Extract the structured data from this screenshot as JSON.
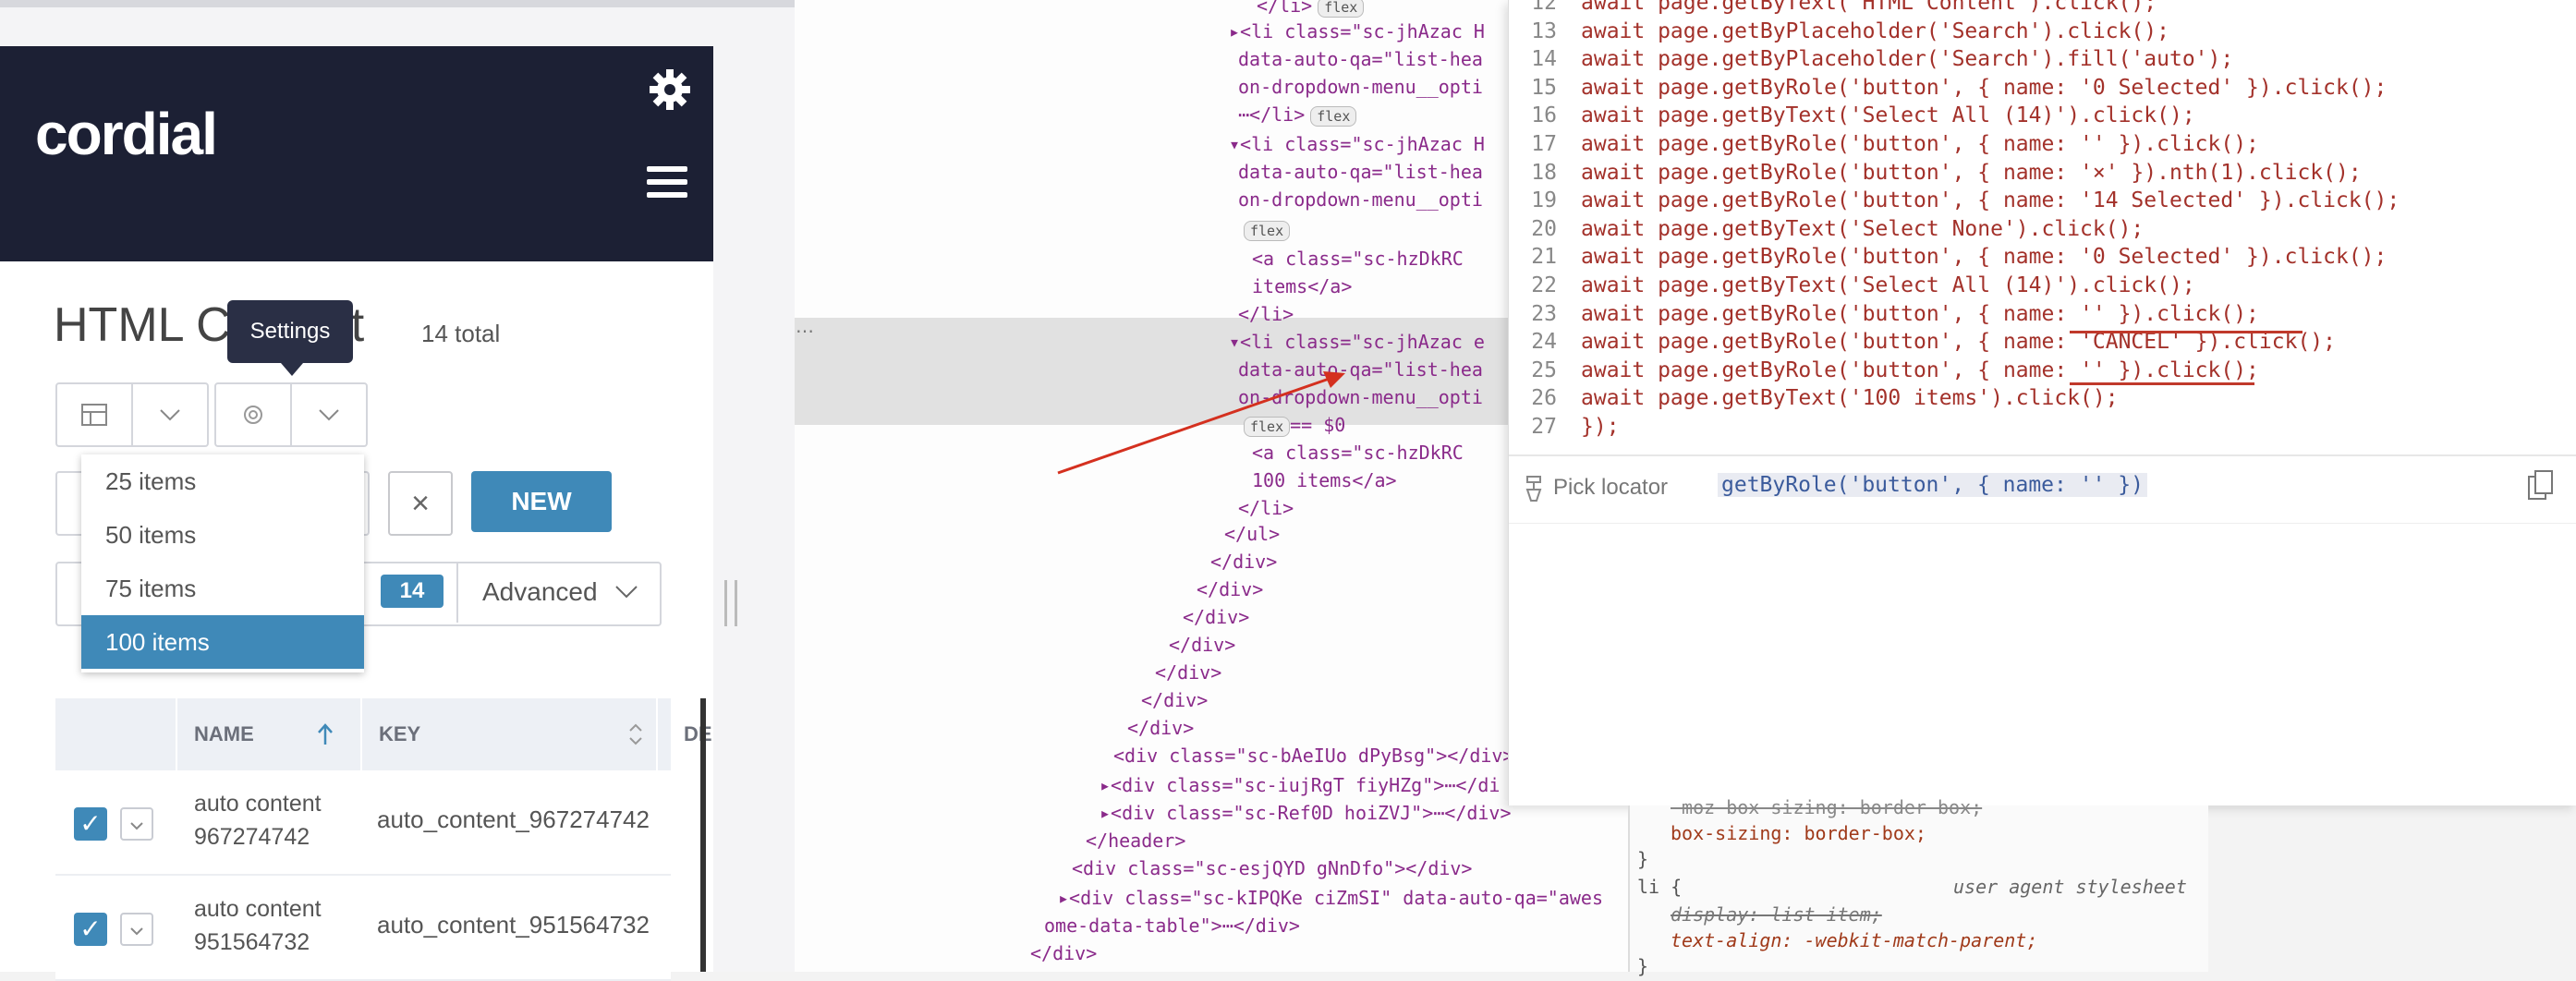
{
  "app": {
    "brand": "cordial",
    "page_title": "HTML Content",
    "total": "14 total",
    "tooltip": "Settings",
    "page_size_options": [
      "25 items",
      "50 items",
      "75 items",
      "100 items"
    ],
    "selected_page_size": "100 items",
    "clear_label": "×",
    "new_label": "NEW",
    "filter_count": "14",
    "advanced_label": "Advanced",
    "table": {
      "columns": [
        "NAME",
        "KEY",
        "DE"
      ],
      "rows": [
        {
          "name": "auto content 967274742",
          "key": "auto_content_967274742"
        },
        {
          "name": "auto content 951564732",
          "key": "auto_content_951564732"
        }
      ]
    }
  },
  "dom": {
    "lines": [
      {
        "text": "</li>",
        "pill": "flex"
      },
      {
        "text": "▸<li class=\"sc-jhAzac H",
        "pill": ""
      },
      {
        "text": "data-auto-qa=\"list-hea",
        "pill": ""
      },
      {
        "text": "on-dropdown-menu__opti",
        "pill": ""
      },
      {
        "text": "⋯</li>",
        "pill": "flex"
      },
      {
        "text": "▾<li class=\"sc-jhAzac H",
        "pill": ""
      },
      {
        "text": "data-auto-qa=\"list-hea",
        "pill": ""
      },
      {
        "text": "on-dropdown-menu__opti",
        "pill": ""
      },
      {
        "text": "",
        "pill": "flex"
      },
      {
        "text": "<a class=\"sc-hzDkRC ",
        "pill": ""
      },
      {
        "text": "items</a>",
        "pill": ""
      },
      {
        "text": "</li>",
        "pill": ""
      },
      {
        "text": "▾<li class=\"sc-jhAzac e",
        "pill": ""
      },
      {
        "text": "data-auto-qa=\"list-hea",
        "pill": ""
      },
      {
        "text": "on-dropdown-menu__opti",
        "pill": ""
      },
      {
        "text": "== $0",
        "pill": "flex"
      },
      {
        "text": "<a class=\"sc-hzDkRC ",
        "pill": ""
      },
      {
        "text": "100 items</a>",
        "pill": ""
      },
      {
        "text": "</li>",
        "pill": ""
      },
      {
        "text": "</ul>",
        "pill": ""
      },
      {
        "text": "</div>",
        "pill": ""
      },
      {
        "text": "</div>",
        "pill": ""
      },
      {
        "text": "</div>",
        "pill": ""
      },
      {
        "text": "</div>",
        "pill": ""
      },
      {
        "text": "</div>",
        "pill": ""
      },
      {
        "text": "</div>",
        "pill": ""
      },
      {
        "text": "</div>",
        "pill": ""
      },
      {
        "text": "<div class=\"sc-bAeIUo dPyBsg\"></div>",
        "pill": ""
      },
      {
        "text": "▸<div class=\"sc-iujRgT fiyHZg\">⋯</di",
        "pill": ""
      },
      {
        "text": "▸<div class=\"sc-Ref0D hoiZVJ\">⋯</div>",
        "pill": ""
      },
      {
        "text": "</header>",
        "pill": ""
      },
      {
        "text": "<div class=\"sc-esjQYD gNnDfo\"></div>",
        "pill": ""
      },
      {
        "text": "▸<div class=\"sc-kIPQKe ciZmSI\" data-auto-qa=\"awes",
        "pill": ""
      },
      {
        "text": "ome-data-table\">⋯</div>",
        "pill": ""
      },
      {
        "text": "</div>",
        "pill": ""
      }
    ],
    "more": "⋯"
  },
  "code": {
    "lines": [
      {
        "n": "12",
        "t": "await page.getByText('HTML Content').click();"
      },
      {
        "n": "13",
        "t": "await page.getByPlaceholder('Search').click();"
      },
      {
        "n": "14",
        "t": "await page.getByPlaceholder('Search').fill('auto');"
      },
      {
        "n": "15",
        "t": "await page.getByRole('button', { name: '0 Selected' }).click();"
      },
      {
        "n": "16",
        "t": "await page.getByText('Select All (14)').click();"
      },
      {
        "n": "17",
        "t": "await page.getByRole('button', { name: '' }).click();"
      },
      {
        "n": "18",
        "t": "await page.getByRole('button', { name: '×' }).nth(1).click();"
      },
      {
        "n": "19",
        "t": "await page.getByRole('button', { name: '14 Selected' }).click();"
      },
      {
        "n": "20",
        "t": "await page.getByText('Select None').click();"
      },
      {
        "n": "21",
        "t": "await page.getByRole('button', { name: '0 Selected' }).click();"
      },
      {
        "n": "22",
        "t": "await page.getByText('Select All (14)').click();"
      },
      {
        "n": "23",
        "t": "await page.getByRole('button', { name: '' }).click();"
      },
      {
        "n": "24",
        "t": "await page.getByRole('button', { name: 'CANCEL' }).click();"
      },
      {
        "n": "25",
        "t": "await page.getByRole('button', { name: '' }).click();"
      },
      {
        "n": "26",
        "t": "await page.getByText('100 items').click();"
      },
      {
        "n": "27",
        "t": "});"
      }
    ],
    "pick_locator_label": "Pick locator",
    "locator_value": "getByRole('button', { name: '' })"
  },
  "styles": {
    "lines": [
      "-moz-box-sizing: border-box;",
      "box-sizing: border-box;",
      "}",
      "li {",
      "display: list-item;",
      "text-align: -webkit-match-parent;",
      "}"
    ],
    "user_agent_label": "user agent stylesheet"
  }
}
